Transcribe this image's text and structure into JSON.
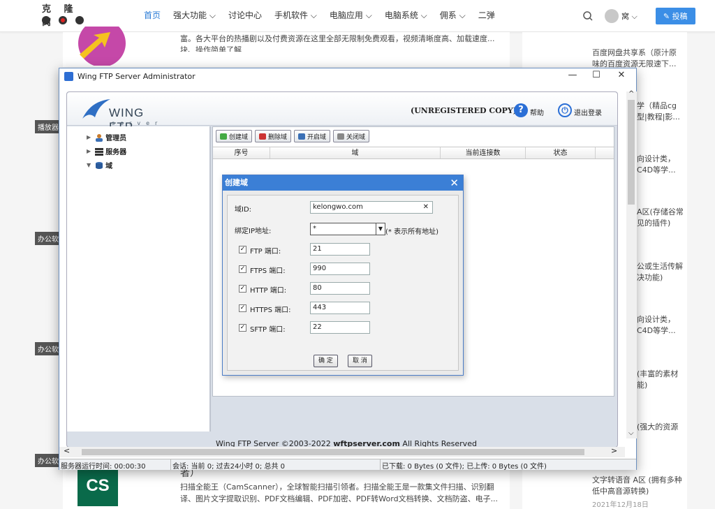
{
  "site": {
    "logo_text": "克 隆 窝",
    "nav": [
      "首页",
      "强大功能",
      "讨论中心",
      "手机软件",
      "电脑应用",
      "电脑系统",
      "佣系",
      "二弹"
    ],
    "user_name": "窝",
    "post_button": "投稿"
  },
  "background": {
    "top_text_1": "富。各大平台的热播剧以及付费资源在这里全部无限制免费观看，视频清晰度高、加载速度...",
    "top_text_2": "块、操作简单了解",
    "tags": [
      "播放器",
      "办公软",
      "办公软",
      "办公软"
    ],
    "right_items": [
      {
        "text": "百度网盘共享系（原汁原味的百度资源无限速下..."
      },
      {
        "text": "学（精品cg型|教程|影..."
      },
      {
        "text": "向设计类，C4D等学..."
      },
      {
        "text": "A区(存储谷常见的插件)"
      },
      {
        "text": "公或生活传解决功能)"
      },
      {
        "text": "向设计类，C4D等学..."
      },
      {
        "text": "(丰富的素材能)"
      },
      {
        "text": "(强大的资源"
      }
    ],
    "bottom_right_title": "文字转语音 A区 (拥有多种低中高音源转换)",
    "bottom_right_date": "2021年12月18日",
    "bottom_left_title": "者）",
    "bottom_text_1": "扫描全能王（CamScanner），全球智能扫描引领者。扫描全能王是一款集文件扫描、识别翻",
    "bottom_text_2": "译、图片文字提取识别、PDF文档编辑、PDF加密、PDF转Word文档转换、文档防盗、电子...",
    "cs_logo": "CS"
  },
  "window": {
    "title": "Wing FTP Server Administrator",
    "min": "—",
    "max": "☐",
    "close": "✕"
  },
  "header": {
    "logo": "WING FTP",
    "logo_sub": "server",
    "unregistered": "(UNREGISTERED COPY)",
    "help_label": "帮助",
    "logout_label": "退出登录"
  },
  "tree": [
    "管理员",
    "服务器",
    "域"
  ],
  "toolbar": [
    "创建域",
    "删除域",
    "开启域",
    "关闭域"
  ],
  "grid_columns": [
    "序号",
    "域",
    "当前连接数",
    "状态"
  ],
  "dialog": {
    "title": "创建域",
    "domain_id_label": "域ID:",
    "domain_id_value": "kelongwo.com",
    "bind_ip_label": "绑定IP地址:",
    "bind_ip_value": "*",
    "bind_ip_hint": "(* 表示所有地址)",
    "ports": [
      {
        "label": "FTP 端口:",
        "value": "21",
        "checked": true
      },
      {
        "label": "FTPS 端口:",
        "value": "990",
        "checked": true
      },
      {
        "label": "HTTP 端口:",
        "value": "80",
        "checked": true
      },
      {
        "label": "HTTPS 端口:",
        "value": "443",
        "checked": true
      },
      {
        "label": "SFTP 端口:",
        "value": "22",
        "checked": true
      }
    ],
    "ok": "确 定",
    "cancel": "取 消"
  },
  "copyright": "Wing FTP Server ©2003-2022 ",
  "copyright_site": "wftpserver.com",
  "copyright_tail": " All Rights Reserved",
  "status": {
    "uptime": "服务器运行时间: 00:00:30",
    "sessions": "会话: 当前 0;  过去24小时 0;  总共 0",
    "transfer": "已下载: 0 Bytes (0 文件);  已上传: 0 Bytes (0 文件)"
  }
}
